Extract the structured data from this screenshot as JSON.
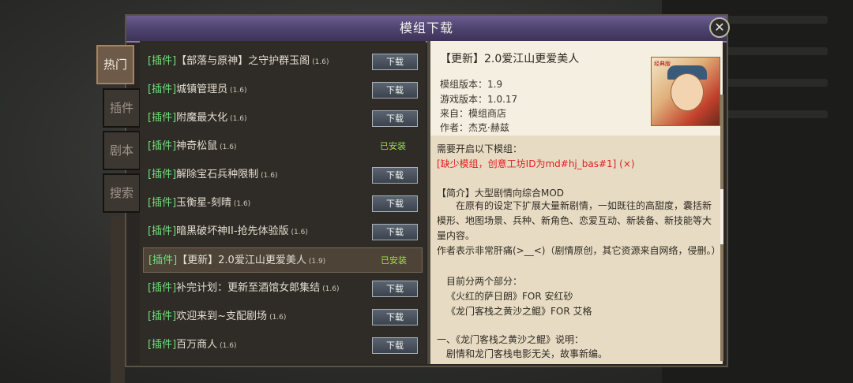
{
  "dialog": {
    "title": "模组下载",
    "close_glyph": "✕"
  },
  "tabs": [
    {
      "label": "热门",
      "active": true
    },
    {
      "label": "插件",
      "active": false
    },
    {
      "label": "剧本",
      "active": false
    },
    {
      "label": "搜索",
      "active": false
    }
  ],
  "mod_list": [
    {
      "tag": "[插件]",
      "name": "【部落与原神】之守护群玉阁",
      "version": "(1.6)",
      "action": "下载"
    },
    {
      "tag": "[插件]",
      "name": "城镇管理员",
      "version": "(1.6)",
      "action": "下载"
    },
    {
      "tag": "[插件]",
      "name": "附魔最大化",
      "version": "(1.6)",
      "action": "下载"
    },
    {
      "tag": "[插件]",
      "name": "神奇松鼠",
      "version": "(1.6)",
      "action": "已安装"
    },
    {
      "tag": "[插件]",
      "name": "解除宝石兵种限制",
      "version": "(1.6)",
      "action": "下载"
    },
    {
      "tag": "[插件]",
      "name": "玉衡星-刻晴",
      "version": "(1.6)",
      "action": "下载"
    },
    {
      "tag": "[插件]",
      "name": "暗黑破坏神II-抢先体验版",
      "version": "(1.6)",
      "action": "下载"
    },
    {
      "tag": "[插件]",
      "name": "【更新】2.0爱江山更爱美人",
      "version": "(1.9)",
      "action": "已安装",
      "selected": true
    },
    {
      "tag": "[插件]",
      "name": "补完计划：更新至酒馆女郎集结",
      "version": "(1.6)",
      "action": "下载"
    },
    {
      "tag": "[插件]",
      "name": "欢迎来到~支配剧场",
      "version": "(1.6)",
      "action": "下载"
    },
    {
      "tag": "[插件]",
      "name": "百万商人",
      "version": "(1.6)",
      "action": "下载"
    }
  ],
  "detail": {
    "title": "【更新】2.0爱江山更爱美人",
    "mod_version": "模组版本：1.9",
    "game_version": "游戏版本：1.0.17",
    "source": "来自：模组商店",
    "author": "作者：杰克·赫兹",
    "thumb_text": "经典版",
    "requires_label": "需要开启以下模组：",
    "missing": "[缺少模组，创意工坊ID为md#hj_bas#1] (×)",
    "intro_heading": "【简介】大型剧情向综合MOD",
    "intro_body": "在原有的设定下扩展大量新剧情，一如既往的高甜度，囊括新模形、地图场景、兵种、新角色、恋爱互动、新装备、新技能等大量内容。",
    "author_note": "作者表示非常肝痛(>__<)（剧情原创，其它资源来自网络，侵删。）",
    "parts_heading": "目前分两个部分：",
    "part1": "《火红的萨日朗》FOR 安红砂",
    "part2": "《龙门客栈之黄沙之鲲》FOR 艾格",
    "section1": "一、《龙门客栈之黄沙之鲲》说明：",
    "section1_body": "剧情和龙门客栈电影无关，故事新编。"
  }
}
